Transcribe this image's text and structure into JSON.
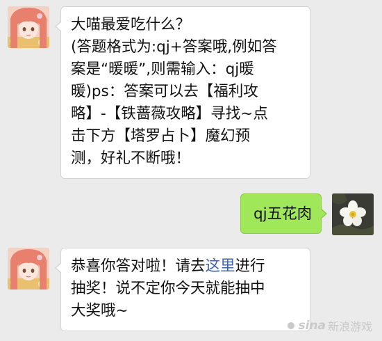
{
  "messages": [
    {
      "sender": "bot",
      "lines": [
        "大喵最爱吃什么？",
        "(答题格式为:qj+答案哦,例如答",
        "案是“暖暖”,则需输入：qj暖",
        "暖)ps：答案可以去【福利攻",
        "略】-【铁蔷薇攻略】寻找~点",
        "击下方【塔罗占卜】魔幻预",
        "测，好礼不断哦！"
      ]
    },
    {
      "sender": "user",
      "text": "qj五花肉"
    },
    {
      "sender": "bot",
      "line1_pre": "恭喜你答对啦！请去",
      "line1_link": "这里",
      "line1_post": "进行",
      "line2": "抽奖！说不定你今天就能抽中",
      "line3": "大奖哦~"
    }
  ],
  "colors": {
    "background": "#ebebeb",
    "user_bubble": "#a0e75a",
    "link": "#3e63a6"
  },
  "watermark": {
    "logo": "sina",
    "text": "新浪游戏"
  }
}
